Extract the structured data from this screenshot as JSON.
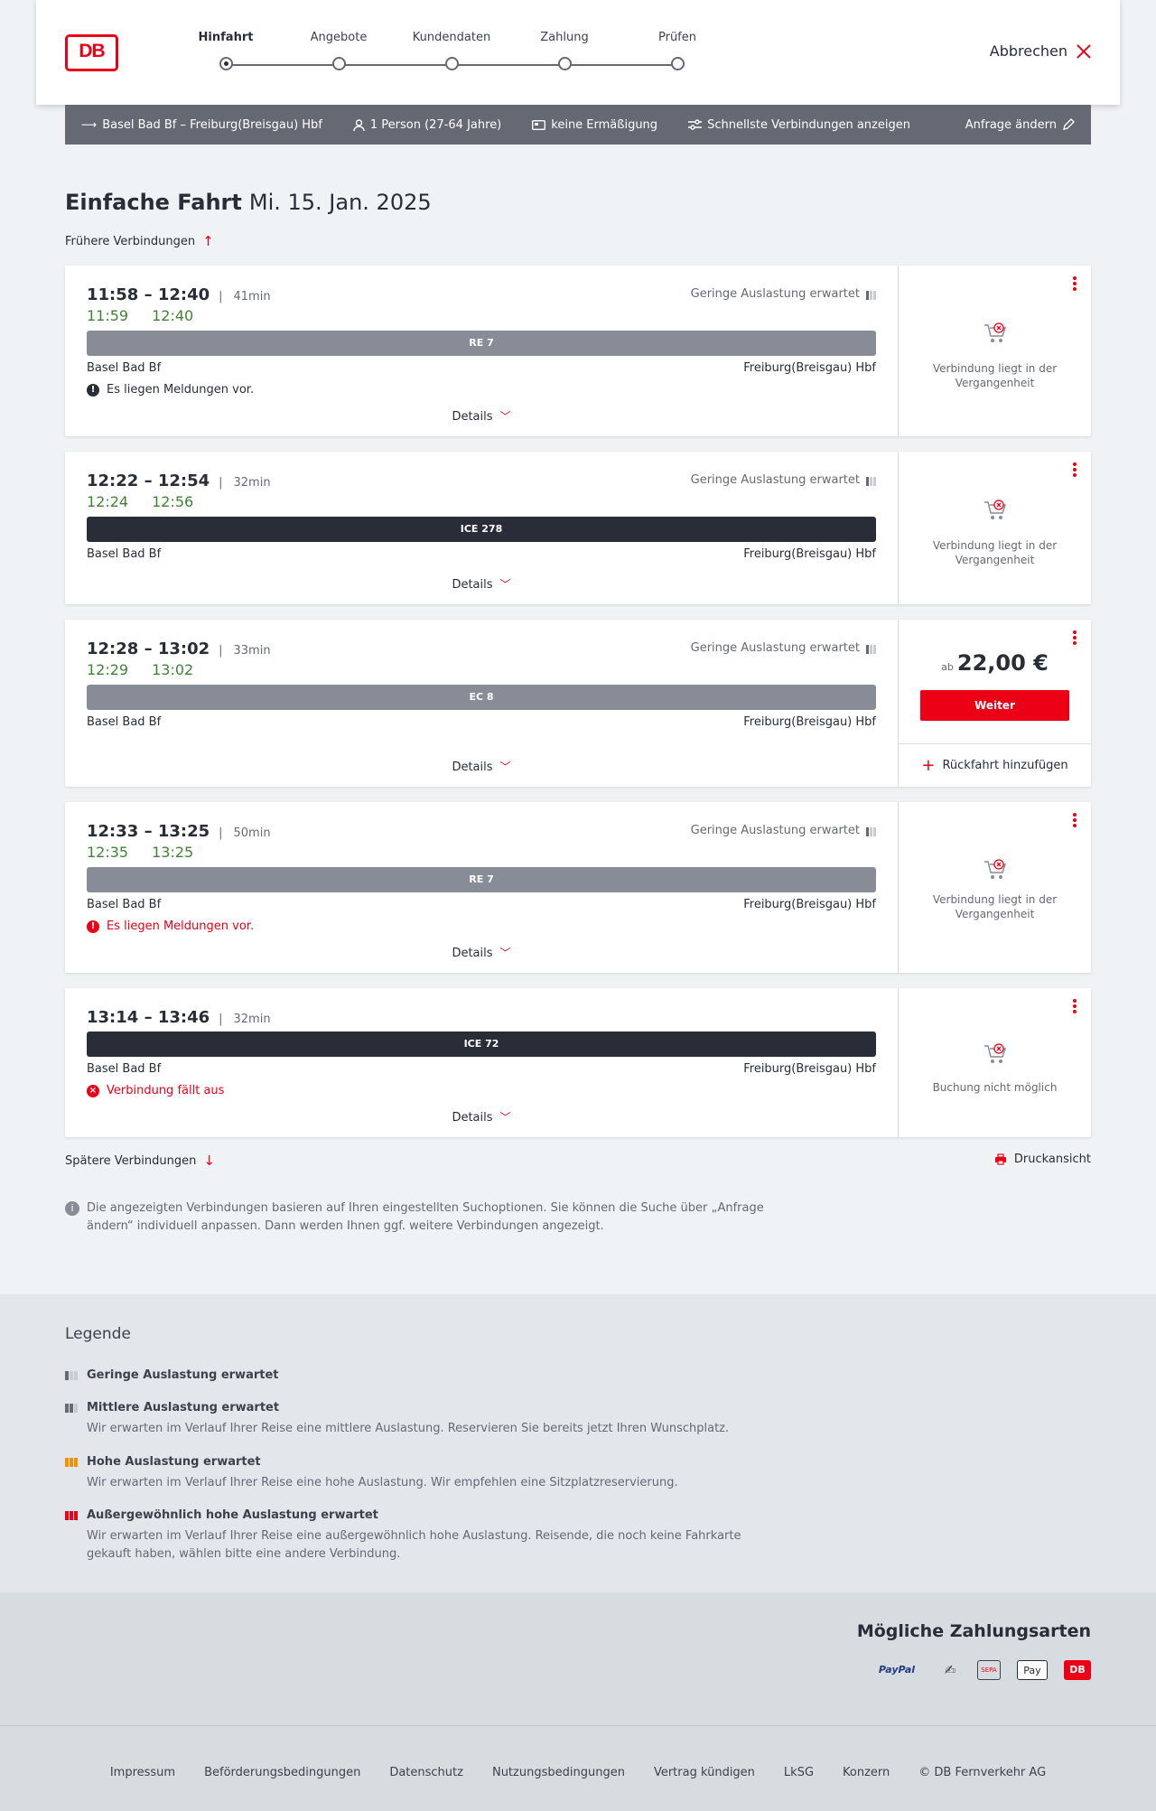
{
  "header": {
    "logo_text": "DB",
    "steps": [
      {
        "label": "Hinfahrt",
        "active": true
      },
      {
        "label": "Angebote",
        "active": false
      },
      {
        "label": "Kundendaten",
        "active": false
      },
      {
        "label": "Zahlung",
        "active": false
      },
      {
        "label": "Prüfen",
        "active": false
      }
    ],
    "cancel_label": "Abbrechen"
  },
  "summary": {
    "route": "Basel Bad Bf – Freiburg(Breisgau) Hbf",
    "passengers": "1 Person (27-64 Jahre)",
    "discount": "keine Ermäßigung",
    "option": "Schnellste Verbindungen anzeigen",
    "edit": "Anfrage ändern"
  },
  "page": {
    "title": "Einfache Fahrt",
    "date": "Mi. 15. Jan. 2025",
    "earlier": "Frühere Verbindungen",
    "later": "Spätere Verbindungen",
    "print": "Druckansicht",
    "details_label": "Details",
    "info": "Die angezeigten Verbindungen basieren auf Ihren eingestellten Suchoptionen. Sie können die Suche über „Anfrage ändern“ individuell anpassen. Dann werden Ihnen ggf. weitere Verbindungen angezeigt."
  },
  "connections": [
    {
      "times": "11:58 – 12:40",
      "duration": "41min",
      "rt_dep": "11:59",
      "rt_arr": "12:40",
      "occupancy": "Geringe Auslastung erwartet",
      "train": "RE 7",
      "from": "Basel Bad Bf",
      "to": "Freiburg(Breisgau) Hbf",
      "message": "Es liegen Meldungen vor.",
      "status": "Verbindung liegt in der Vergangenheit"
    },
    {
      "times": "12:22 – 12:54",
      "duration": "32min",
      "rt_dep": "12:24",
      "rt_arr": "12:56",
      "occupancy": "Geringe Auslastung erwartet",
      "train": "ICE 278",
      "from": "Basel Bad Bf",
      "to": "Freiburg(Breisgau) Hbf",
      "status": "Verbindung liegt in der Vergangenheit"
    },
    {
      "times": "12:28 – 13:02",
      "duration": "33min",
      "rt_dep": "12:29",
      "rt_arr": "13:02",
      "occupancy": "Geringe Auslastung erwartet",
      "train": "EC 8",
      "from": "Basel Bad Bf",
      "to": "Freiburg(Breisgau) Hbf",
      "price_prefix": "ab",
      "price": "22,00 €",
      "button": "Weiter",
      "return": "Rückfahrt hinzufügen"
    },
    {
      "times": "12:33 – 13:25",
      "duration": "50min",
      "rt_dep": "12:35",
      "rt_arr": "13:25",
      "occupancy": "Geringe Auslastung erwartet",
      "train": "RE 7",
      "from": "Basel Bad Bf",
      "to": "Freiburg(Breisgau) Hbf",
      "message": "Es liegen Meldungen vor.",
      "status": "Verbindung liegt in der Vergangenheit"
    },
    {
      "times": "13:14 – 13:46",
      "duration": "32min",
      "train": "ICE 72",
      "from": "Basel Bad Bf",
      "to": "Freiburg(Breisgau) Hbf",
      "message": "Verbindung fällt aus",
      "status": "Buchung nicht möglich"
    }
  ],
  "legend": {
    "title": "Legende",
    "items": [
      {
        "title": "Geringe Auslastung erwartet",
        "desc": ""
      },
      {
        "title": "Mittlere Auslastung erwartet",
        "desc": "Wir erwarten im Verlauf Ihrer Reise eine mittlere Auslastung. Reservieren Sie bereits jetzt Ihren Wunschplatz."
      },
      {
        "title": "Hohe Auslastung erwartet",
        "desc": "Wir erwarten im Verlauf Ihrer Reise eine hohe Auslastung. Wir empfehlen eine Sitzplatzreservierung."
      },
      {
        "title": "Außergewöhnlich hohe Auslastung erwartet",
        "desc": "Wir erwarten im Verlauf Ihrer Reise eine außergewöhnlich hohe Auslastung. Reisende, die noch keine Fahrkarte gekauft haben, wählen bitte eine andere Verbindung."
      }
    ]
  },
  "payment": {
    "title": "Mögliche Zahlungsarten",
    "methods": [
      "PayPal",
      "Lastschrift",
      "SEPA",
      "Pay",
      "DB"
    ]
  },
  "footer": {
    "links": [
      "Impressum",
      "Beförderungsbedingungen",
      "Datenschutz",
      "Nutzungsbedingungen",
      "Vertrag kündigen",
      "LkSG",
      "Konzern",
      "© DB Fernverkehr AG"
    ]
  },
  "colors": {
    "db_red": "#ec0016",
    "on_time_green": "#408335",
    "summary_bar": "#646973",
    "train_grey": "#878c96",
    "train_dark": "#282d37"
  }
}
